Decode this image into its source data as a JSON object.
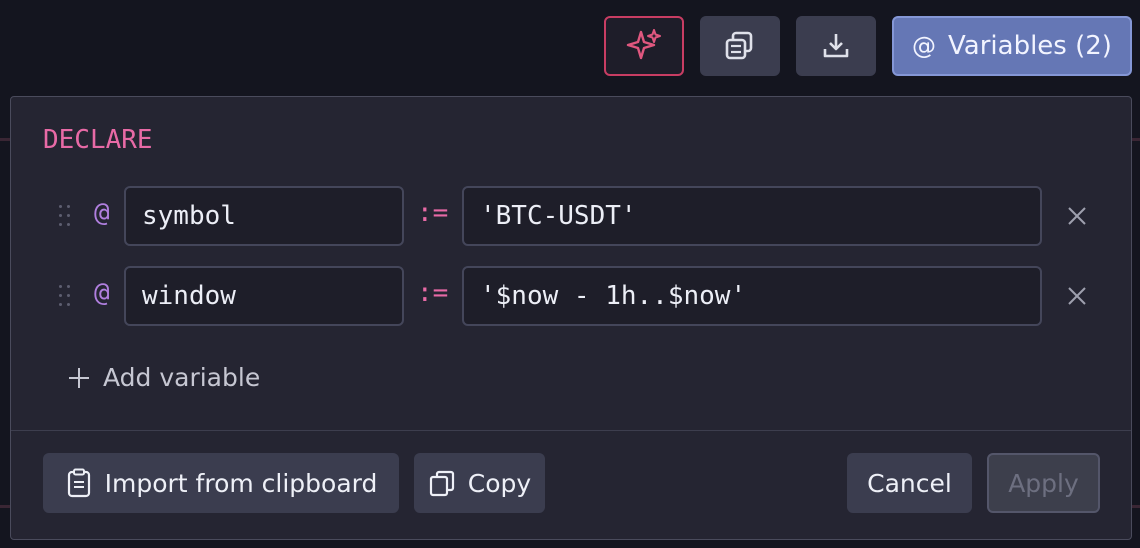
{
  "toolbar": {
    "ai_icon": "sparkles-icon",
    "duplicate_icon": "duplicate-icon",
    "download_icon": "download-icon",
    "variables_prefix": "@",
    "variables_label": "Variables (2)"
  },
  "popover": {
    "keyword": "DECLARE",
    "variables": [
      {
        "prefix": "@",
        "name": "symbol",
        "operator": ":=",
        "value": "'BTC-USDT'"
      },
      {
        "prefix": "@",
        "name": "window",
        "operator": ":=",
        "value": "'$now - 1h..$now'"
      }
    ],
    "add_label": "Add variable",
    "import_label": "Import from clipboard",
    "copy_label": "Copy",
    "cancel_label": "Cancel",
    "apply_label": "Apply"
  },
  "colors": {
    "keyword": "#e86aa6",
    "at_sign": "#b07fdf",
    "variables_button": "#6577b5",
    "ai_border": "#c83d63"
  }
}
